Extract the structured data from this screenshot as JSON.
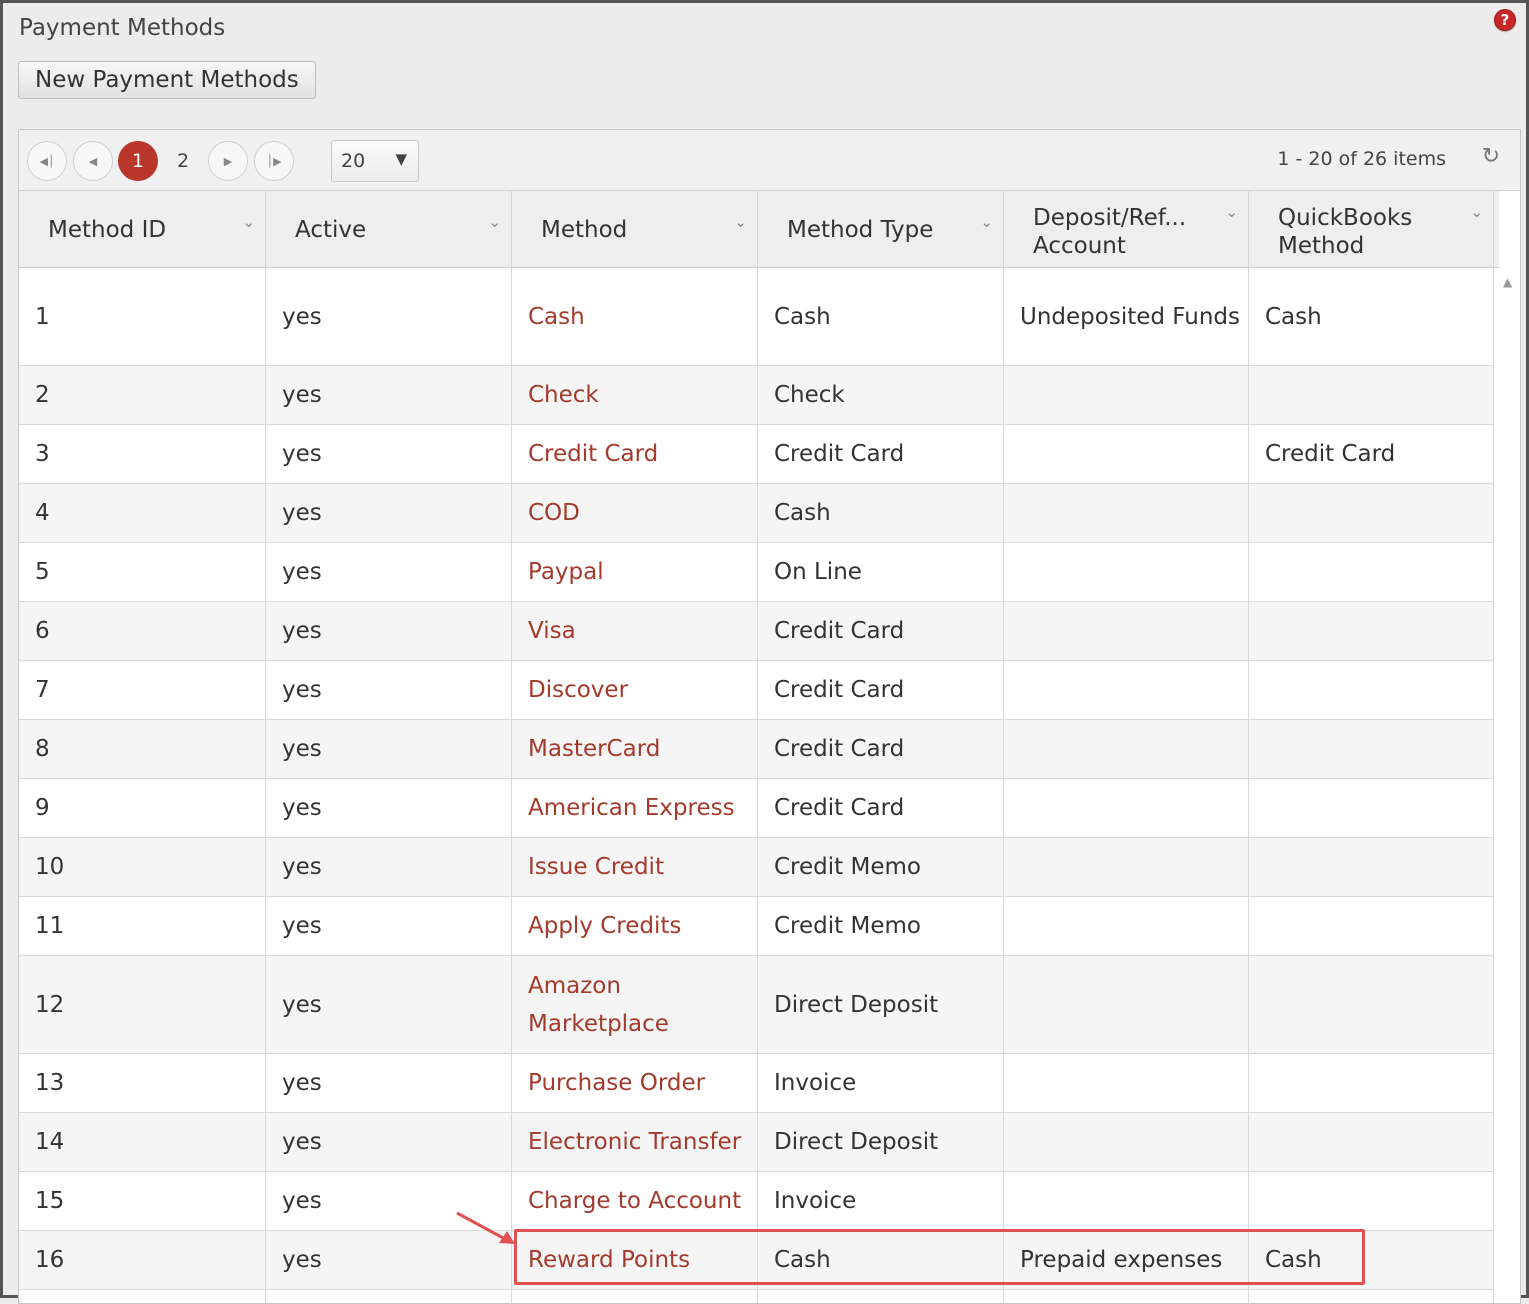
{
  "page": {
    "title": "Payment Methods",
    "help_icon": "question-icon"
  },
  "toolbar": {
    "new_label": "New Payment Methods"
  },
  "pager": {
    "pages": [
      "1",
      "2"
    ],
    "current_page": "1",
    "page_size": "20",
    "info": "1 - 20 of 26 items",
    "icons": [
      "first-page-icon",
      "prev-page-icon",
      "next-page-icon",
      "last-page-icon",
      "refresh-icon"
    ]
  },
  "columns": [
    "Method ID",
    "Active",
    "Method",
    "Method Type",
    "Deposit/Ref... Account",
    "QuickBooks Method"
  ],
  "column_lines": [
    [
      "Method ID"
    ],
    [
      "Active"
    ],
    [
      "Method"
    ],
    [
      "Method Type"
    ],
    [
      "Deposit/Ref...",
      "Account"
    ],
    [
      "QuickBooks",
      "Method"
    ]
  ],
  "rows": [
    {
      "id": "1",
      "active": "yes",
      "method": "Cash",
      "type": "Cash",
      "deposit": "Undeposited Funds",
      "qb": "Cash"
    },
    {
      "id": "2",
      "active": "yes",
      "method": "Check",
      "type": "Check",
      "deposit": "",
      "qb": ""
    },
    {
      "id": "3",
      "active": "yes",
      "method": "Credit Card",
      "type": "Credit Card",
      "deposit": "",
      "qb": "Credit Card"
    },
    {
      "id": "4",
      "active": "yes",
      "method": "COD",
      "type": "Cash",
      "deposit": "",
      "qb": ""
    },
    {
      "id": "5",
      "active": "yes",
      "method": "Paypal",
      "type": "On Line",
      "deposit": "",
      "qb": ""
    },
    {
      "id": "6",
      "active": "yes",
      "method": "Visa",
      "type": "Credit Card",
      "deposit": "",
      "qb": ""
    },
    {
      "id": "7",
      "active": "yes",
      "method": "Discover",
      "type": "Credit Card",
      "deposit": "",
      "qb": ""
    },
    {
      "id": "8",
      "active": "yes",
      "method": "MasterCard",
      "type": "Credit Card",
      "deposit": "",
      "qb": ""
    },
    {
      "id": "9",
      "active": "yes",
      "method": "American Express",
      "type": "Credit Card",
      "deposit": "",
      "qb": ""
    },
    {
      "id": "10",
      "active": "yes",
      "method": "Issue Credit",
      "type": "Credit Memo",
      "deposit": "",
      "qb": ""
    },
    {
      "id": "11",
      "active": "yes",
      "method": "Apply Credits",
      "type": "Credit Memo",
      "deposit": "",
      "qb": ""
    },
    {
      "id": "12",
      "active": "yes",
      "method": "Amazon Marketplace",
      "type": "Direct Deposit",
      "deposit": "",
      "qb": ""
    },
    {
      "id": "13",
      "active": "yes",
      "method": "Purchase Order",
      "type": "Invoice",
      "deposit": "",
      "qb": ""
    },
    {
      "id": "14",
      "active": "yes",
      "method": "Electronic Transfer",
      "type": "Direct Deposit",
      "deposit": "",
      "qb": ""
    },
    {
      "id": "15",
      "active": "yes",
      "method": "Charge to Account",
      "type": "Invoice",
      "deposit": "",
      "qb": ""
    },
    {
      "id": "16",
      "active": "yes",
      "method": "Reward Points",
      "type": "Cash",
      "deposit": "Prepaid expenses",
      "qb": "Cash"
    },
    {
      "id": "",
      "active": "",
      "method": "",
      "type": "",
      "deposit": "",
      "qb": ""
    }
  ],
  "colors": {
    "accent": "#b9362b",
    "link": "#a33a2c",
    "highlight": "#e05252"
  }
}
